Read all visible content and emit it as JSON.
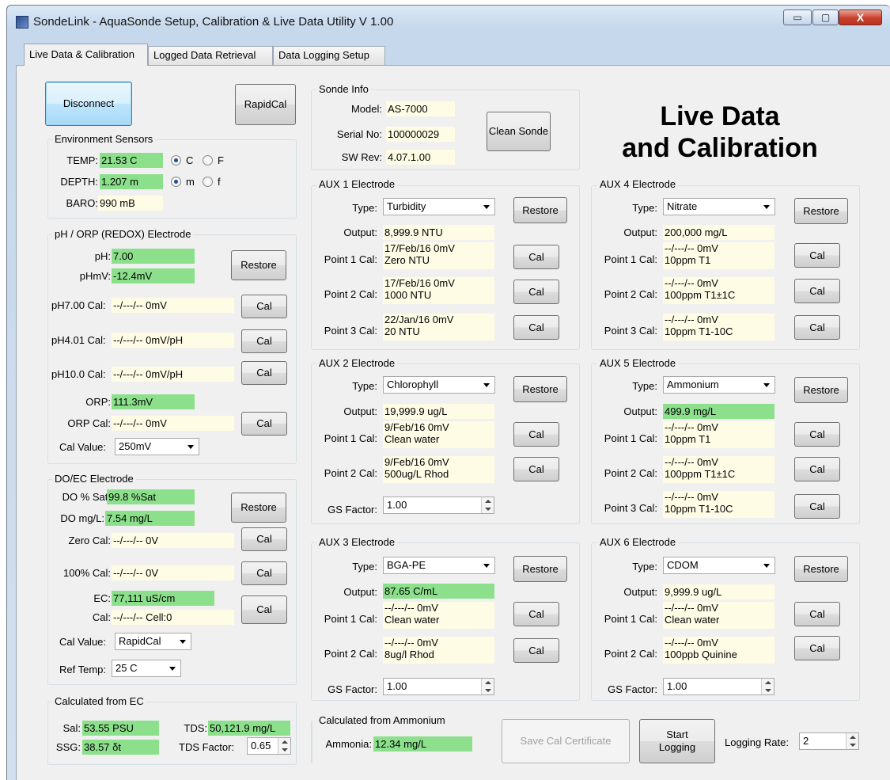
{
  "window": {
    "title": "SondeLink - AquaSonde Setup, Calibration & Live Data Utility V 1.00",
    "min": "▭",
    "max": "▢",
    "close": "X"
  },
  "tabs": [
    "Live Data & Calibration",
    "Logged Data Retrieval",
    "Data Logging Setup"
  ],
  "left": {
    "disconnect": "Disconnect",
    "rapidcal": "RapidCal",
    "env": {
      "title": "Environment Sensors",
      "temp_label": "TEMP:",
      "temp": "21.53 C",
      "c": "C",
      "f": "F",
      "depth_label": "DEPTH:",
      "depth": "1.207 m",
      "m": "m",
      "ft": "f",
      "baro_label": "BARO:",
      "baro": "990 mB"
    },
    "ph": {
      "title": "pH / ORP (REDOX) Electrode",
      "ph_label": "pH:",
      "ph": "7.00",
      "phmv_label": "pHmV:",
      "phmv": "-12.4mV",
      "restore": "Restore",
      "cal7_label": "pH7.00 Cal:",
      "cal7": "--/---/-- 0mV",
      "cal4_label": "pH4.01 Cal:",
      "cal4": "--/---/-- 0mV/pH",
      "cal10_label": "pH10.0 Cal:",
      "cal10": "--/---/-- 0mV/pH",
      "orp_label": "ORP:",
      "orp": "111.3mV",
      "orpcal_label": "ORP Cal:",
      "orpcal": "--/---/-- 0mV",
      "calvalue_label": "Cal Value:",
      "calvalue": "250mV",
      "cal": "Cal"
    },
    "do": {
      "title": "DO/EC Electrode",
      "dosat_label": "DO % Sat:",
      "dosat": "99.8 %Sat",
      "domg_label": "DO mg/L:",
      "domg": "7.54 mg/L",
      "restore": "Restore",
      "zero_label": "Zero Cal:",
      "zero": "--/---/-- 0V",
      "hundred_label": "100% Cal:",
      "hundred": "--/---/-- 0V",
      "ec_label": "EC:",
      "ec": "77,111 uS/cm",
      "eccal_label": "Cal:",
      "eccal": "--/---/-- Cell:0",
      "calvalue_label": "Cal Value:",
      "calvalue": "RapidCal",
      "reftemp_label": "Ref Temp:",
      "reftemp": "25 C",
      "cal": "Cal"
    },
    "calc": {
      "title": "Calculated from EC",
      "sal_label": "Sal:",
      "sal": "53.55 PSU",
      "ssg_label": "SSG:",
      "ssg": "38.57 δt",
      "tds_label": "TDS:",
      "tds": "50,121.9 mg/L",
      "tdsf_label": "TDS Factor:",
      "tdsf": "0.65"
    }
  },
  "sonde": {
    "title": "Sonde Info",
    "model_label": "Model:",
    "model": "AS-7000",
    "serial_label": "Serial No:",
    "serial": "100000029",
    "sw_label": "SW Rev:",
    "sw": "4.07.1.00",
    "clean": "Clean Sonde"
  },
  "heading": {
    "l1": "Live Data",
    "l2": "and Calibration"
  },
  "labels": {
    "type": "Type:",
    "output": "Output:",
    "p1": "Point 1 Cal:",
    "p2": "Point 2 Cal:",
    "p3": "Point 3 Cal:",
    "gs": "GS Factor:",
    "restore": "Restore",
    "cal": "Cal"
  },
  "aux1": {
    "title": "AUX 1 Electrode",
    "type": "Turbidity",
    "output": "8,999.9 NTU",
    "p1a": "17/Feb/16  0mV",
    "p1b": "Zero NTU",
    "p2a": "17/Feb/16  0mV",
    "p2b": "1000 NTU",
    "p3a": "22/Jan/16  0mV",
    "p3b": "20 NTU"
  },
  "aux2": {
    "title": "AUX 2 Electrode",
    "type": "Chlorophyll",
    "output": "19,999.9 ug/L",
    "p1a": "9/Feb/16  0mV",
    "p1b": "Clean water",
    "p2a": "9/Feb/16  0mV",
    "p2b": "500ug/L Rhod",
    "gs": "1.00"
  },
  "aux3": {
    "title": "AUX 3 Electrode",
    "type": "BGA-PE",
    "output": "87.65 C/mL",
    "p1a": "--/---/--  0mV",
    "p1b": "Clean water",
    "p2a": "--/---/--  0mV",
    "p2b": "8ug/l Rhod",
    "gs": "1.00"
  },
  "aux4": {
    "title": "AUX 4 Electrode",
    "type": "Nitrate",
    "output": "200,000 mg/L",
    "p1a": "--/---/--  0mV",
    "p1b": "10ppm T1",
    "p2a": "--/---/--  0mV",
    "p2b": "100ppm T1±1C",
    "p3a": "--/---/--  0mV",
    "p3b": "10ppm T1-10C"
  },
  "aux5": {
    "title": "AUX 5 Electrode",
    "type": "Ammonium",
    "output": "499.9 mg/L",
    "p1a": "--/---/--  0mV",
    "p1b": "10ppm T1",
    "p2a": "--/---/--  0mV",
    "p2b": "100ppm T1±1C",
    "p3a": "--/---/--  0mV",
    "p3b": "10ppm T1-10C"
  },
  "aux6": {
    "title": "AUX 6 Electrode",
    "type": "CDOM",
    "output": "9,999.9 ug/L",
    "p1a": "--/---/--  0mV",
    "p1b": "Clean water",
    "p2a": "--/---/--  0mV",
    "p2b": "100ppb Quinine",
    "gs": "1.00"
  },
  "amm": {
    "title": "Calculated from Ammonium",
    "label": "Ammonia:",
    "value": "12.34 mg/L"
  },
  "footer": {
    "save": "Save Cal Certificate",
    "start": "Start Logging",
    "rate_label": "Logging Rate:",
    "rate": "2"
  }
}
